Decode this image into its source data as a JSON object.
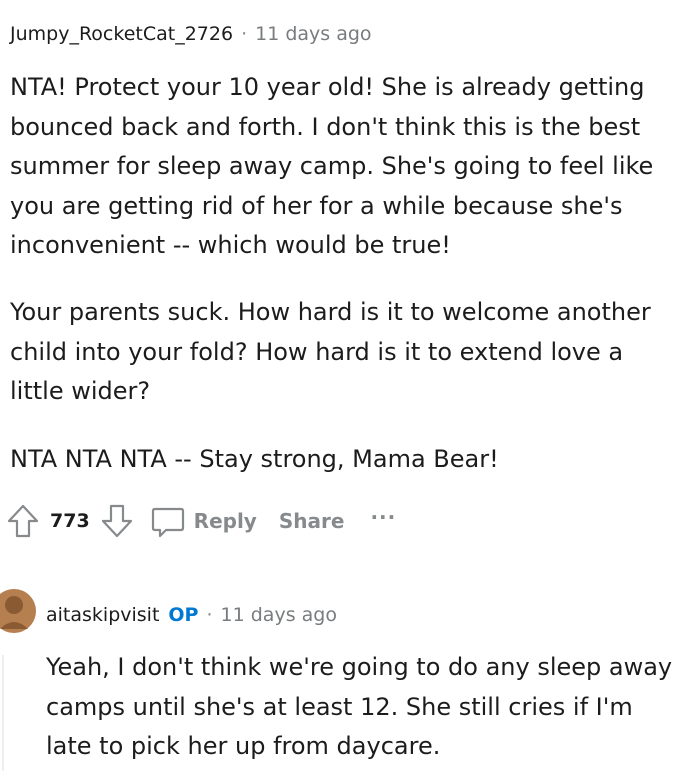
{
  "comment1": {
    "username": "Jumpy_RocketCat_2726",
    "separator": "·",
    "timestamp": "11 days ago",
    "paragraphs": [
      "NTA! Protect your 10 year old! She is already getting bounced back and forth. I don't think this is the best summer for sleep away camp. She's going to feel like you are getting rid of her for a while because she's inconvenient -- which would be true!",
      "Your parents suck. How hard is it to welcome another child into your fold? How hard is it to extend love a little wider?",
      "NTA NTA NTA -- Stay strong, Mama Bear!"
    ],
    "votes": "773",
    "reply_label": "Reply",
    "share_label": "Share",
    "more_label": "···"
  },
  "comment2": {
    "username": "aitaskipvisit",
    "op_badge": "OP",
    "separator": "·",
    "timestamp": "11 days ago",
    "text": "Yeah, I don't think we're going to do any sleep away camps until she's at least 12. She still cries if I'm late to pick her up from daycare."
  },
  "icons": {
    "upvote": "upvote-arrow-icon",
    "downvote": "downvote-arrow-icon",
    "comment": "comment-bubble-icon",
    "avatar": "user-avatar"
  },
  "colors": {
    "meta_gray": "#787c7e",
    "action_gray": "#878a8c",
    "op_blue": "#0079d3",
    "avatar_fill": "#b57f4f"
  }
}
